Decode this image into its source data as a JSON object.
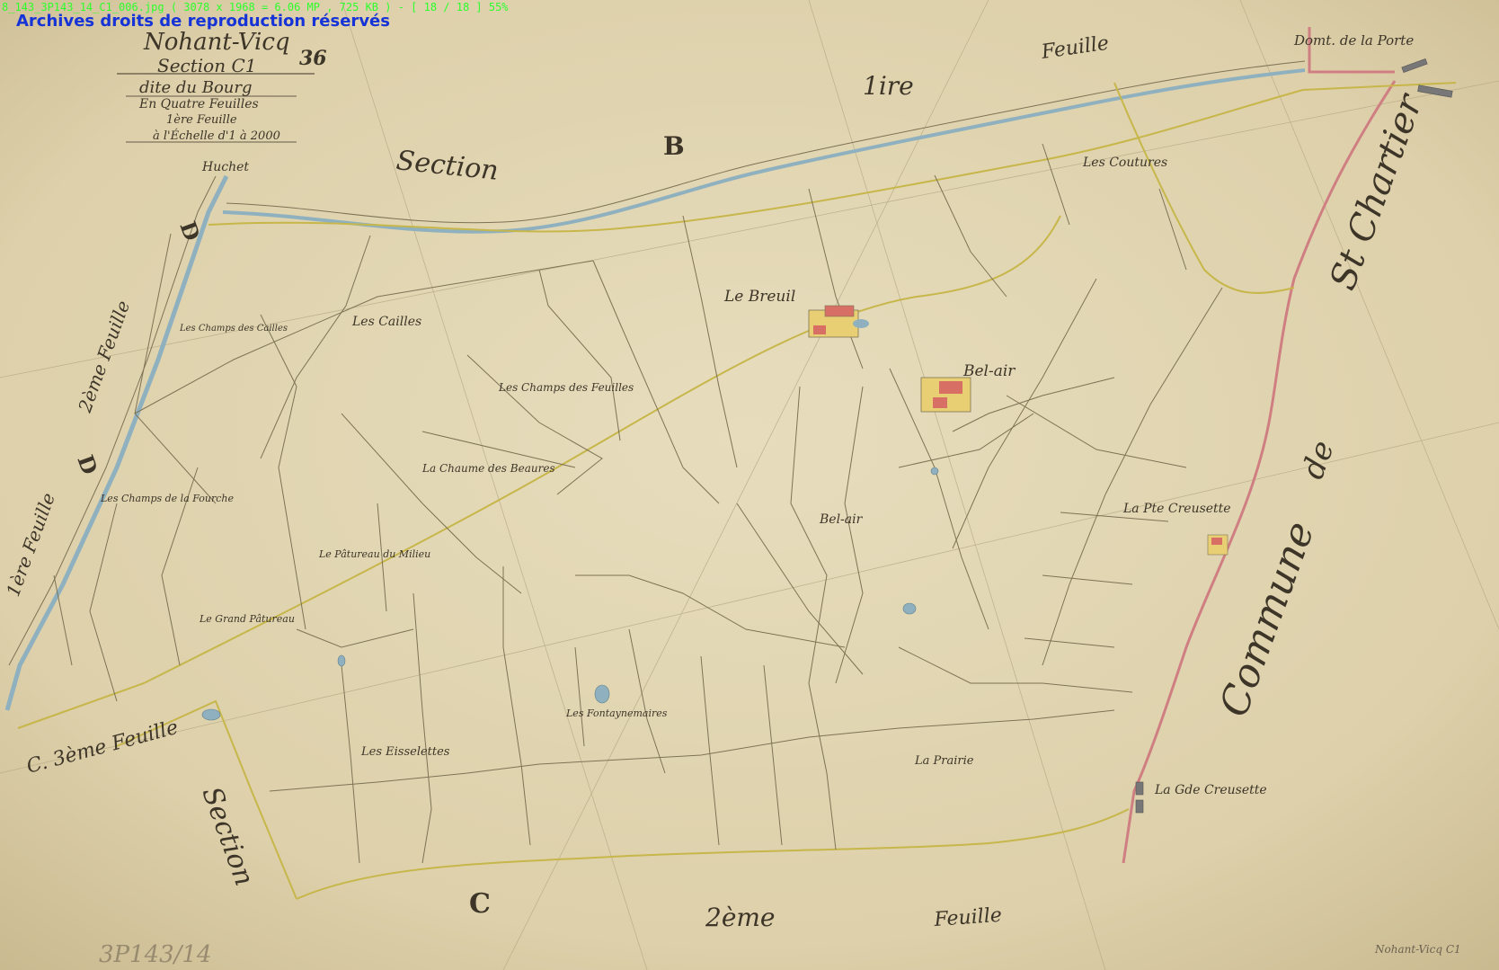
{
  "viewer": {
    "info_line": "8_143_3P143_14_C1_006.jpg ( 3078 x 1968 = 6.06 MP ,  725 KB ) - [ 18 / 18 ]  55%",
    "watermark": "Archives droits de reproduction réservés"
  },
  "cartouche": {
    "commune": "Nohant-Vicq",
    "section": "Section C1",
    "section_number": "36",
    "dite": "dite du Bourg",
    "feuilles": "En Quatre Feuilles",
    "feuille": "1ère Feuille",
    "echelle": "à l'Échelle d'1 à 2000",
    "signature": "Huchet"
  },
  "labels": {
    "section_b": "Section",
    "letter_b": "B",
    "feuille_top": "Feuille",
    "ire": "1ire",
    "domaine_porte": "Domt. de la Porte",
    "commune_st_chartier_1": "Commune",
    "commune_st_chartier_2": "de",
    "commune_st_chartier_3": "St Chartier",
    "d_letter_top": "D",
    "d_2eme_feuille": "2ème Feuille",
    "d_letter_bottom": "D",
    "d_1ere_feuille": "1ère Feuille",
    "c_3eme_feuille": "C. 3ème Feuille",
    "section_c": "Section",
    "letter_c": "C",
    "deuxieme": "2ème",
    "feuille_bottom": "Feuille",
    "archive_ref": "3P143/14",
    "footer_note": "Nohant-Vicq C1"
  },
  "places": {
    "le_breuil": "Le Breuil",
    "bel_air_house": "Bel-air",
    "bel_air_field": "Bel-air",
    "les_coutures": "Les Coutures",
    "les_cailles": "Les Cailles",
    "champs_des_cailles": "Les Champs des Cailles",
    "champs_des_feuilles": "Les Champs des Feuilles",
    "chaume_des_beaures": "La Chaume des Beaures",
    "champs_de_la_fourche": "Les Champs de la Fourche",
    "paturaux_du_milieu": "Le Pâtureau du Milieu",
    "grand_paturau": "Le Grand Pâtureau",
    "les_eisselettes": "Les Eisselettes",
    "les_fontaynemaires": "Les Fontaynemaires",
    "la_prairie": "La Prairie",
    "petite_creusette": "La Pte Creusette",
    "grande_creusette": "La Gde Creusette"
  },
  "colors": {
    "paper": "#ddd2ae",
    "parcel_line": "#7d7355",
    "yellow_road": "#c7b64a",
    "river_blue": "#8fb1bf",
    "commune_border": "#cf7f82",
    "building": "#d86f64",
    "yard": "#e8cf73",
    "ink": "#3d3528",
    "hud_green": "#2cff2c",
    "watermark_blue": "#1533d6"
  }
}
